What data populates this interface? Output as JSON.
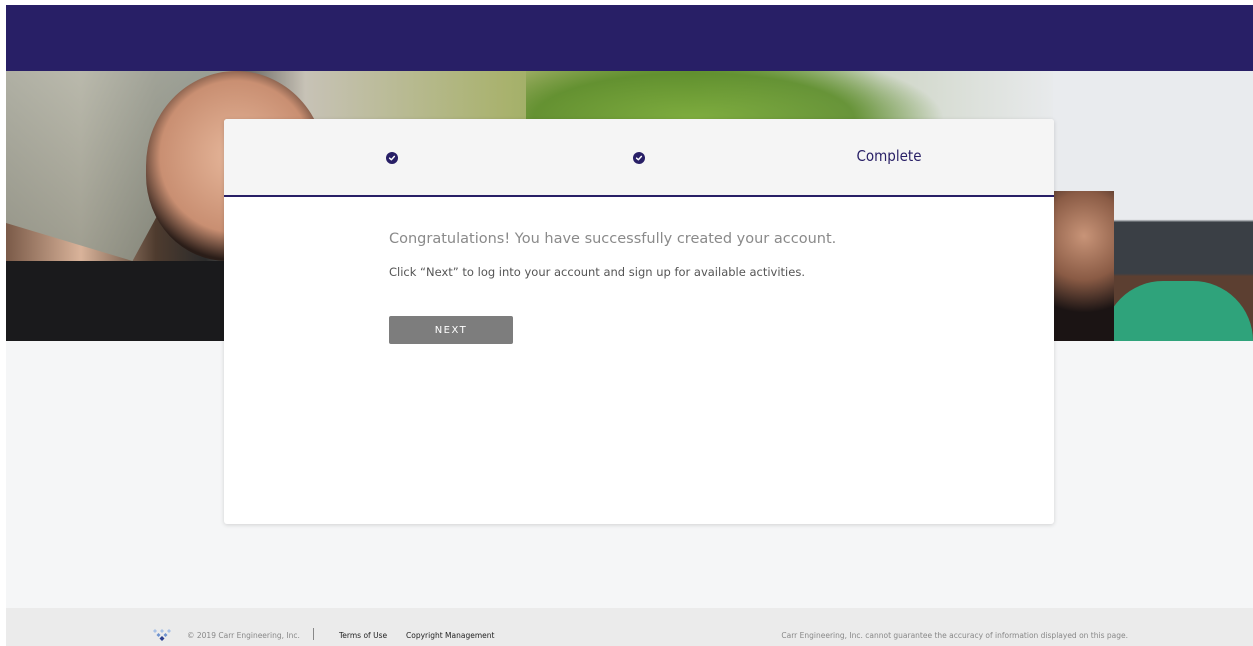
{
  "wizard": {
    "steps": [
      {
        "label": "",
        "status": "done",
        "icon": "check-circle-icon"
      },
      {
        "label": "",
        "status": "done",
        "icon": "check-circle-icon"
      },
      {
        "label": "Complete",
        "status": "current"
      }
    ]
  },
  "message": {
    "title": "Congratulations! You have successfully created your account.",
    "subtitle": "Click “Next” to log into your account and sign up for available activities."
  },
  "actions": {
    "next_label": "NEXT"
  },
  "footer": {
    "copyright": "© 2019 Carr Engineering, Inc.",
    "links": [
      "Terms of Use",
      "Copyright Management"
    ],
    "disclaimer": "Carr Engineering, Inc. cannot guarantee the accuracy of information displayed on this page."
  },
  "colors": {
    "brand_navy": "#281f66",
    "button_gray": "#7d7d7d",
    "page_bg": "#f5f6f7"
  }
}
